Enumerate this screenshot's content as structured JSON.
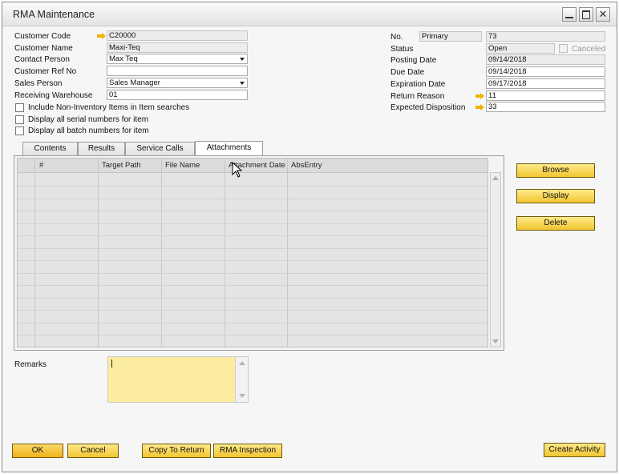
{
  "window": {
    "title": "RMA Maintenance"
  },
  "header_left": {
    "customer_code_label": "Customer Code",
    "customer_code": "C20000",
    "customer_name_label": "Customer Name",
    "customer_name": "Maxi-Teq",
    "contact_person_label": "Contact Person",
    "contact_person": "Max Teq",
    "customer_ref_label": "Customer Ref No",
    "customer_ref": "",
    "sales_person_label": "Sales Person",
    "sales_person": "Sales Manager",
    "receiving_warehouse_label": "Receiving Warehouse",
    "receiving_warehouse": "01"
  },
  "options": {
    "include_non_inventory": "Include Non-Inventory Items in Item searches",
    "display_serial": "Display all serial numbers for item",
    "display_batch": "Display all batch numbers for item"
  },
  "header_right": {
    "no_label": "No.",
    "series": "Primary",
    "number": "73",
    "status_label": "Status",
    "status": "Open",
    "canceled_label": "Canceled",
    "posting_date_label": "Posting Date",
    "posting_date": "09/14/2018",
    "due_date_label": "Due Date",
    "due_date": "09/14/2018",
    "expiration_date_label": "Expiration Date",
    "expiration_date": "09/17/2018",
    "return_reason_label": "Return Reason",
    "return_reason": "11",
    "expected_disposition_label": "Expected Disposition",
    "expected_disposition": "33"
  },
  "tabs": [
    {
      "label": "Contents"
    },
    {
      "label": "Results"
    },
    {
      "label": "Service Calls"
    },
    {
      "label": "Attachments",
      "active": true
    }
  ],
  "attachments_table": {
    "columns": [
      "#",
      "Target Path",
      "File Name",
      "Attachment Date",
      "AbsEntry"
    ],
    "rows": []
  },
  "side_buttons": {
    "browse": "Browse",
    "display": "Display",
    "delete": "Delete"
  },
  "remarks": {
    "label": "Remarks",
    "value": ""
  },
  "footer": {
    "ok": "OK",
    "cancel": "Cancel",
    "copy_to_return": "Copy To Return",
    "rma_inspection": "RMA Inspection",
    "create_activity": "Create Activity"
  },
  "colors": {
    "button_yellow": "#f3c52f",
    "remarks_bg": "#fbeca0",
    "link_arrow": "#f0b400"
  }
}
